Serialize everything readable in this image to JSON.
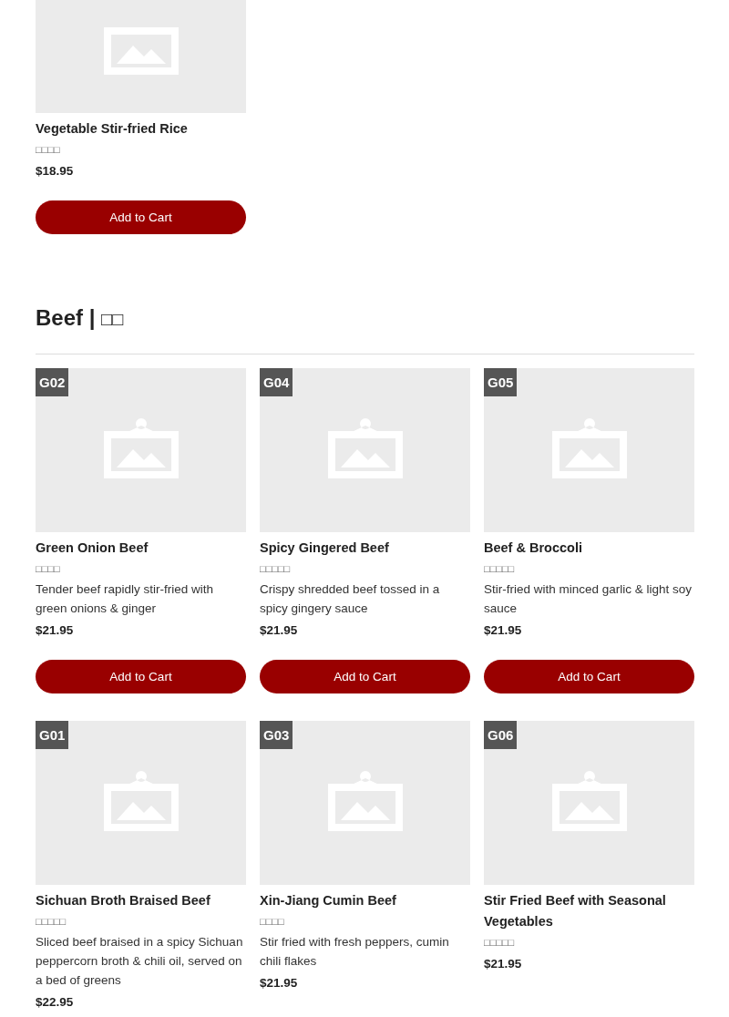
{
  "top_items": [
    {
      "name": "Vegetable Stir-fried Rice",
      "chinese_name": "□□□□",
      "price": "$18.95",
      "button": "Add to Cart"
    }
  ],
  "section": {
    "title": "Beef | ",
    "title_chinese": "□□",
    "items": [
      {
        "code": "G02",
        "name": "Green Onion Beef",
        "chinese_name": "□□□□",
        "description": "Tender beef rapidly stir-fried with green onions & ginger",
        "price": "$21.95",
        "button": "Add to Cart"
      },
      {
        "code": "G04",
        "name": "Spicy Gingered Beef",
        "chinese_name": "□□□□□",
        "description": "Crispy shredded beef tossed in a spicy gingery sauce",
        "price": "$21.95",
        "button": "Add to Cart"
      },
      {
        "code": "G05",
        "name": "Beef & Broccoli",
        "chinese_name": "□□□□□",
        "description": "Stir-fried with minced garlic & light soy sauce",
        "price": "$21.95",
        "button": "Add to Cart"
      },
      {
        "code": "G01",
        "name": "Sichuan Broth Braised Beef",
        "chinese_name": "□□□□□",
        "description": "Sliced beef braised in a spicy Sichuan peppercorn broth & chili oil, served on a bed of greens",
        "price": "$22.95"
      },
      {
        "code": "G03",
        "name": "Xin-Jiang Cumin Beef",
        "chinese_name": "□□□□",
        "description": "Stir fried with fresh peppers, cumin chili flakes",
        "price": "$21.95"
      },
      {
        "code": "G06",
        "name": "Stir Fried Beef with Seasonal Vegetables",
        "chinese_name": "□□□□□",
        "price": "$21.95"
      }
    ]
  }
}
